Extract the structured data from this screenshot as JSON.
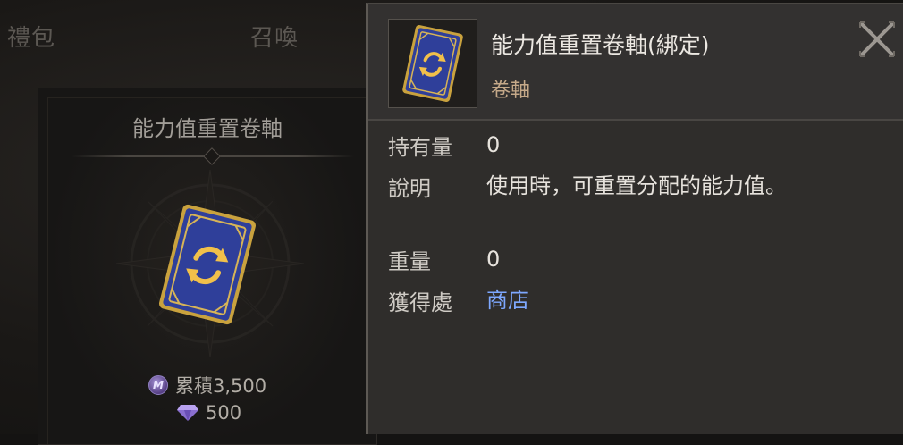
{
  "tabs": {
    "gift": "禮包",
    "summon": "召喚"
  },
  "product": {
    "title": "能力值重置卷軸",
    "accumulated_price": "累積3,500",
    "gem_price": "500",
    "coin_icon_letter": "M"
  },
  "tooltip": {
    "item_name": "能力值重置卷軸(綁定)",
    "category": "卷軸",
    "fields": {
      "quantity_label": "持有量",
      "quantity_value": "0",
      "description_label": "說明",
      "description_value": "使用時，可重置分配的能力值。",
      "weight_label": "重量",
      "weight_value": "0",
      "source_label": "獲得處",
      "source_value": "商店"
    }
  },
  "icons": {
    "close": "close-icon",
    "item": "scroll-card-icon",
    "currency_accum": "mileage-coin-icon",
    "currency_gem": "diamond-gem-icon"
  },
  "colors": {
    "link": "#7ea8ff",
    "category": "#c5a989",
    "card_blue": "#2f3f9a",
    "card_gold": "#c9a23e"
  }
}
